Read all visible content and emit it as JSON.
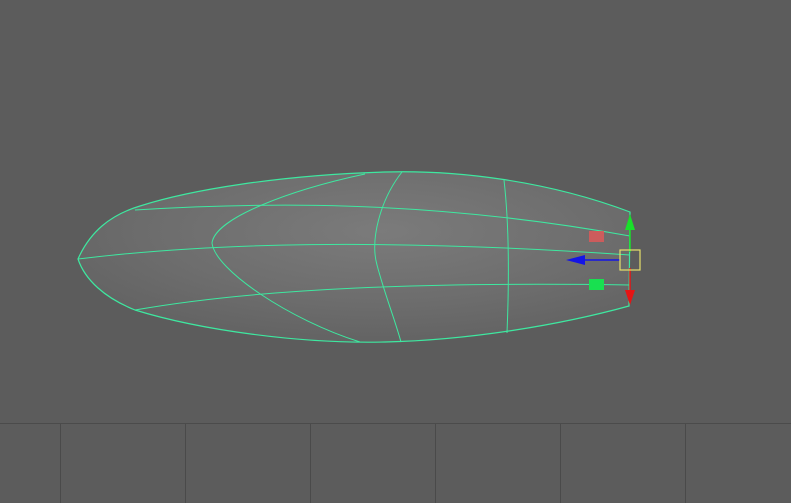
{
  "viewport": {
    "background_color": "#5c5c5c",
    "wire_color": "#3ee8a0",
    "surface_color": "#6e6e6e"
  },
  "manipulator": {
    "y_axis_color": "#19e02a",
    "z_axis_color": "#1414e6",
    "x_axis_color": "#e61414",
    "pivot_box_color": "#e7e06a",
    "red_handle_color": "#d65a5a",
    "green_handle_color": "#18e050"
  },
  "bottom_strip": {
    "cell_count": 7
  }
}
